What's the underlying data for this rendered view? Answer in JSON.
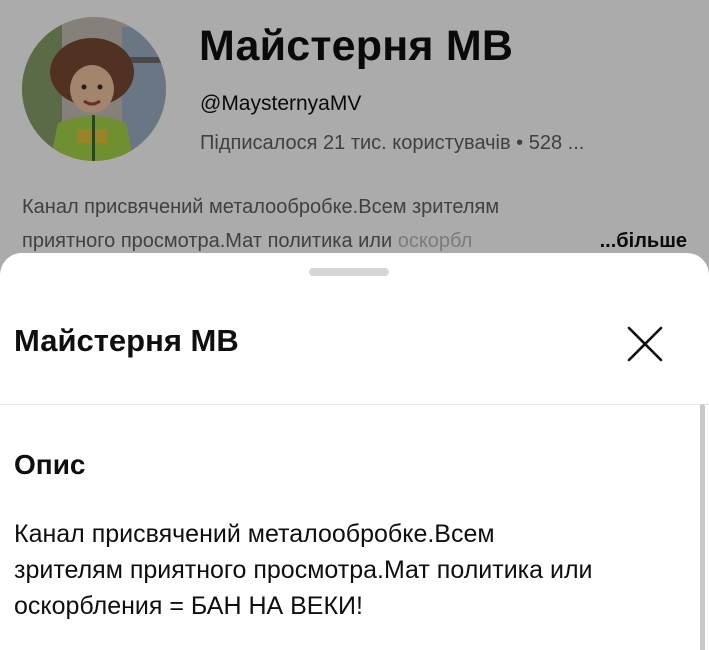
{
  "channel": {
    "title": "Майстерня МВ",
    "handle": "@MaysternyaMV",
    "stats": "Підписалося 21 тис. користувачів • 528 ...",
    "description_line1": "Канал присвячений металообробке.Всем зрителям",
    "description_line2_visible": "приятного просмотра.Мат политика или ",
    "description_line2_fade": "оскорбл",
    "more_label": "...більше",
    "avatar_icon": "channel-avatar-photo"
  },
  "sheet": {
    "title": "Майстерня МВ",
    "close_icon": "close-icon",
    "section_heading": "Опис",
    "description_line1": "Канал присвячений металообробке.Всем",
    "description_line2": "зрителям приятного просмотра.Мат политика или",
    "description_line3": "оскорбления = БАН НА ВЕКИ!"
  },
  "colors": {
    "scrim": "rgba(0,0,0,0.33)",
    "text_primary": "#0f0f0f",
    "text_secondary": "#606060"
  }
}
